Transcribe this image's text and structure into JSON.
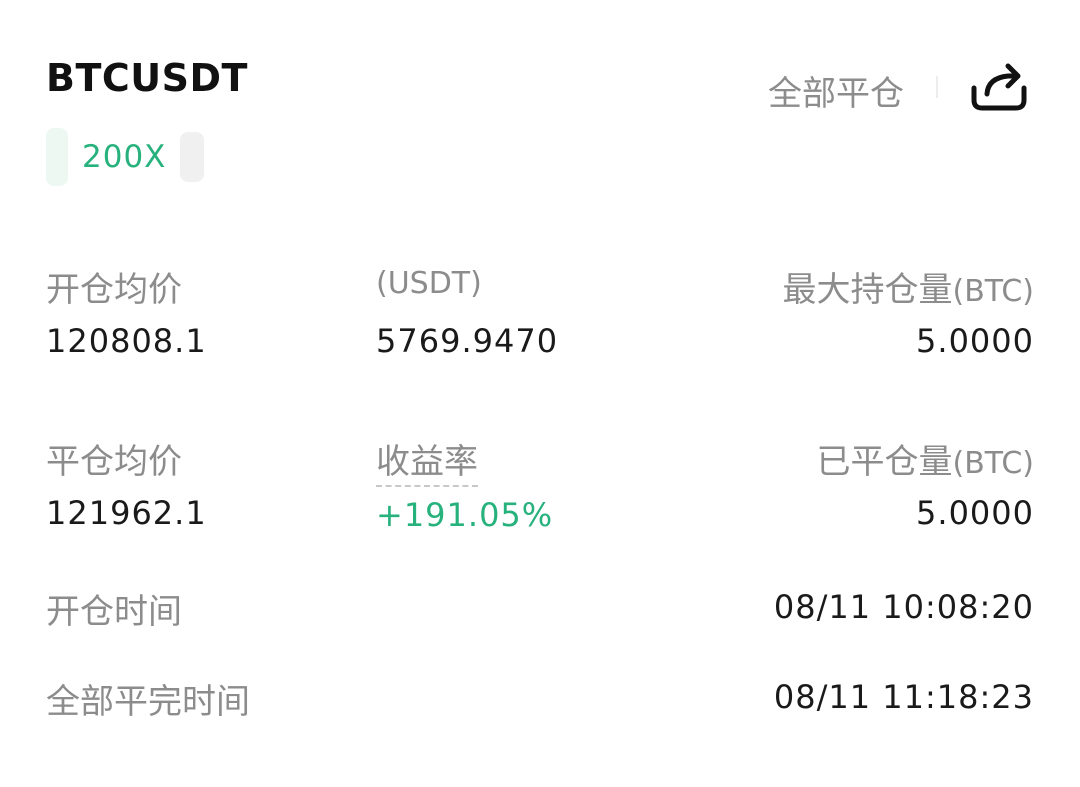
{
  "header": {
    "symbol": "BTCUSDT",
    "close_all": "全部平仓",
    "share_icon": "share-icon"
  },
  "leverage": "200X",
  "row1": {
    "open_avg_label": "开仓均价",
    "open_avg_value": "120808.1",
    "mid_label": "(USDT)",
    "mid_value": "5769.9470",
    "max_pos_label": "最大持仓量",
    "max_pos_unit": "(BTC)",
    "max_pos_value": "5.0000"
  },
  "row2": {
    "close_avg_label": "平仓均价",
    "close_avg_value": "121962.1",
    "yield_label": "收益率",
    "yield_value": "+191.05%",
    "closed_label": "已平仓量",
    "closed_unit": "(BTC)",
    "closed_value": "5.0000"
  },
  "times": {
    "open_time_label": "开仓时间",
    "open_time_value": "08/11 10:08:20",
    "close_time_label": "全部平完时间",
    "close_time_value": "08/11 11:18:23"
  },
  "colors": {
    "profit_green": "#27b27d",
    "label_gray": "#8c8c8c",
    "text_dark": "#1a1a1a"
  }
}
